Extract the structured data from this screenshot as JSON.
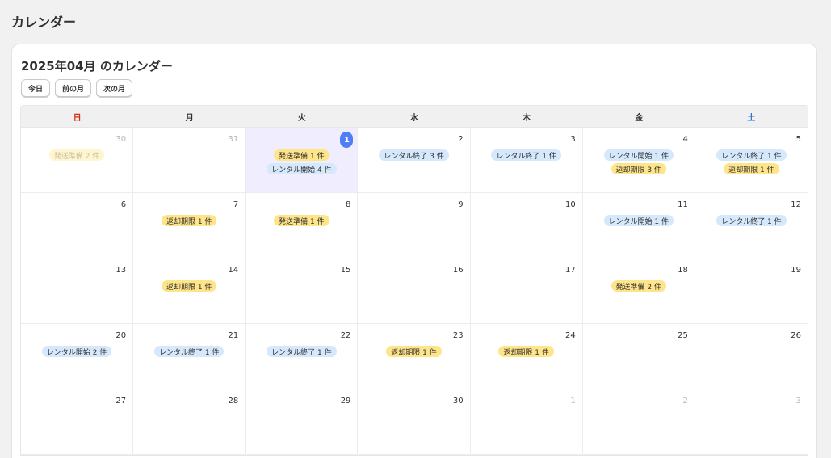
{
  "page": {
    "title": "カレンダー"
  },
  "calendar": {
    "heading": "2025年04月 のカレンダー",
    "nav": {
      "today": "今日",
      "prev": "前の月",
      "next": "次の月"
    },
    "weekdays": [
      "日",
      "月",
      "火",
      "水",
      "木",
      "金",
      "土"
    ],
    "weekday_colors": {
      "sunday": "#d72c0d",
      "saturday": "#2c6ecb"
    },
    "event_colors": {
      "shipping_and_due": "#ffe58a",
      "rental": "#d6e8fb",
      "today": "#4f7ef5"
    },
    "weeks": [
      [
        {
          "day": "30",
          "other": true,
          "events": [
            {
              "label": "発送準備 2 件",
              "color": "yellow"
            }
          ]
        },
        {
          "day": "31",
          "other": true,
          "events": []
        },
        {
          "day": "1",
          "today": true,
          "events": [
            {
              "label": "発送準備 1 件",
              "color": "yellow"
            },
            {
              "label": "レンタル開始 4 件",
              "color": "blue"
            }
          ]
        },
        {
          "day": "2",
          "events": [
            {
              "label": "レンタル終了 3 件",
              "color": "blue"
            }
          ]
        },
        {
          "day": "3",
          "events": [
            {
              "label": "レンタル終了 1 件",
              "color": "blue"
            }
          ]
        },
        {
          "day": "4",
          "events": [
            {
              "label": "レンタル開始 1 件",
              "color": "blue"
            },
            {
              "label": "返却期限 3 件",
              "color": "yellow"
            }
          ]
        },
        {
          "day": "5",
          "events": [
            {
              "label": "レンタル終了 1 件",
              "color": "blue"
            },
            {
              "label": "返却期限 1 件",
              "color": "yellow"
            }
          ]
        }
      ],
      [
        {
          "day": "6",
          "events": []
        },
        {
          "day": "7",
          "events": [
            {
              "label": "返却期限 1 件",
              "color": "yellow"
            }
          ]
        },
        {
          "day": "8",
          "events": [
            {
              "label": "発送準備 1 件",
              "color": "yellow"
            }
          ]
        },
        {
          "day": "9",
          "events": []
        },
        {
          "day": "10",
          "events": []
        },
        {
          "day": "11",
          "events": [
            {
              "label": "レンタル開始 1 件",
              "color": "blue"
            }
          ]
        },
        {
          "day": "12",
          "events": [
            {
              "label": "レンタル終了 1 件",
              "color": "blue"
            }
          ]
        }
      ],
      [
        {
          "day": "13",
          "events": []
        },
        {
          "day": "14",
          "events": [
            {
              "label": "返却期限 1 件",
              "color": "yellow"
            }
          ]
        },
        {
          "day": "15",
          "events": []
        },
        {
          "day": "16",
          "events": []
        },
        {
          "day": "17",
          "events": []
        },
        {
          "day": "18",
          "events": [
            {
              "label": "発送準備 2 件",
              "color": "yellow"
            }
          ]
        },
        {
          "day": "19",
          "events": []
        }
      ],
      [
        {
          "day": "20",
          "events": [
            {
              "label": "レンタル開始 2 件",
              "color": "blue"
            }
          ]
        },
        {
          "day": "21",
          "events": [
            {
              "label": "レンタル終了 1 件",
              "color": "blue"
            }
          ]
        },
        {
          "day": "22",
          "events": [
            {
              "label": "レンタル終了 1 件",
              "color": "blue"
            }
          ]
        },
        {
          "day": "23",
          "events": [
            {
              "label": "返却期限 1 件",
              "color": "yellow"
            }
          ]
        },
        {
          "day": "24",
          "events": [
            {
              "label": "返却期限 1 件",
              "color": "yellow"
            }
          ]
        },
        {
          "day": "25",
          "events": []
        },
        {
          "day": "26",
          "events": []
        }
      ],
      [
        {
          "day": "27",
          "events": []
        },
        {
          "day": "28",
          "events": []
        },
        {
          "day": "29",
          "events": []
        },
        {
          "day": "30",
          "events": []
        },
        {
          "day": "1",
          "other": true,
          "events": []
        },
        {
          "day": "2",
          "other": true,
          "events": []
        },
        {
          "day": "3",
          "other": true,
          "events": []
        }
      ]
    ]
  }
}
